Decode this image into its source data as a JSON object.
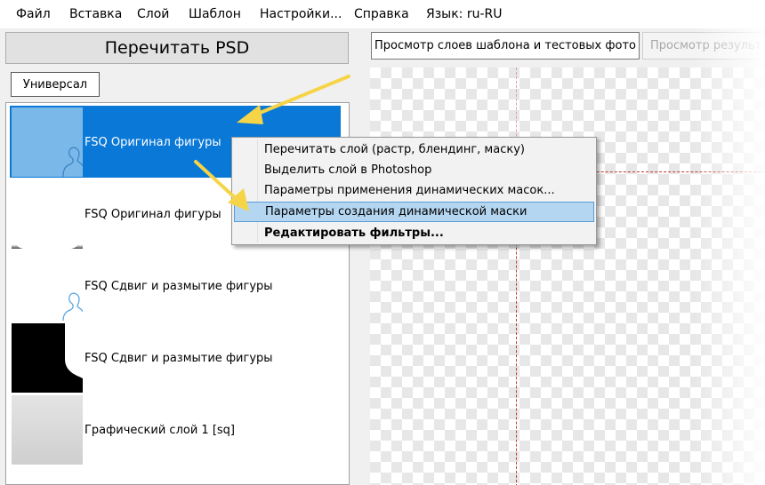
{
  "menubar": {
    "items": [
      {
        "label": "Файл"
      },
      {
        "label": "Вставка"
      },
      {
        "label": "Слой"
      },
      {
        "label": "Шаблон"
      },
      {
        "label": "Настройки..."
      },
      {
        "label": "Справка"
      },
      {
        "label": "Язык: ru-RU"
      }
    ]
  },
  "left_panel": {
    "reread_button": "Перечитать PSD",
    "tab_universal": "Универсал",
    "layers": [
      {
        "name": "FSQ Оригинал фигуры",
        "selected": true,
        "thumb": "blue-silhouette"
      },
      {
        "name": "FSQ Оригинал фигуры",
        "selected": false,
        "thumb": "white-mask"
      },
      {
        "name": "FSQ Сдвиг и размытие фигуры",
        "selected": false,
        "thumb": "outline-figure"
      },
      {
        "name": "FSQ Сдвиг и размытие фигуры",
        "selected": false,
        "thumb": "black-mask"
      },
      {
        "name": "Графический слой 1 [sq]",
        "selected": false,
        "thumb": "gray-square"
      }
    ]
  },
  "right_panel": {
    "tab_preview": "Просмотр слоев шаблона и тестовых фото",
    "tab_result": "Просмотр результ"
  },
  "context_menu": {
    "items": [
      {
        "label": "Перечитать слой (растр, блендинг, маску)",
        "hover": false,
        "bold": false
      },
      {
        "label": "Выделить слой в Photoshop",
        "hover": false,
        "bold": false
      },
      {
        "label": "Параметры применения динамических масок...",
        "hover": false,
        "bold": false
      },
      {
        "label": "Параметры создания динамической маски",
        "hover": true,
        "bold": false
      },
      {
        "label": "Редактировать фильтры...",
        "hover": false,
        "bold": true
      }
    ]
  },
  "colors": {
    "selection": "#0a78d7",
    "menu_hover": "#b4d6f1",
    "arrow": "#f5d547",
    "guide": "#c0392b"
  }
}
